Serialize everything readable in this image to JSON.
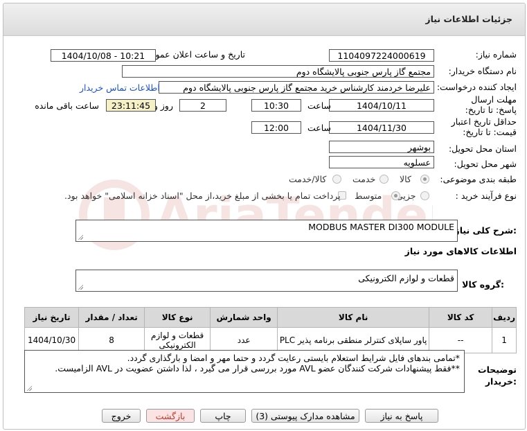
{
  "header": {
    "title": "جزئیات اطلاعات نیاز"
  },
  "fields": {
    "need_number_label": "شماره نیاز:",
    "need_number": "1104097224000619",
    "announce_label": "تاریخ و ساعت اعلان عمومی:",
    "announce_value": "1404/10/08 - 10:21",
    "buyer_org_label": "نام دستگاه خریدار:",
    "buyer_org": "مجتمع گاز پارس جنوبی  پالایشگاه دوم",
    "requester_label": "ایجاد کننده درخواست:",
    "requester": "علیرضا خردمند کارشناس خرید مجتمع گاز پارس جنوبی  پالایشگاه دوم",
    "contact_link": "اطلاعات تماس خریدار",
    "deadline_label": "مهلت ارسال پاسخ: تا تاریخ:",
    "deadline_date": "1404/10/11",
    "time_label": "ساعت",
    "deadline_time": "10:30",
    "days_value": "2",
    "days_label": "روز و",
    "remaining_time": "23:11:45",
    "remaining_label": "ساعت باقی مانده",
    "validity_label": "حداقل تاریخ اعتبار قیمت: تا تاریخ:",
    "validity_date": "1404/11/30",
    "validity_time": "12:00",
    "province_label": "استان محل تحویل:",
    "province": "بوشهر",
    "city_label": "شهر محل تحویل:",
    "city": "عسلویه",
    "category_label": "طبقه بندی موضوعی:",
    "category_options": [
      "کالا",
      "خدمت",
      "کالا/خدمت"
    ],
    "process_label": "نوع فرآیند خرید :",
    "process_options": [
      "جزیی",
      "متوسط"
    ],
    "treasury_note": "پرداخت تمام یا بخشی از مبلغ خرید،از محل \"اسناد خزانه اسلامی\" خواهد بود."
  },
  "summary": {
    "label": "شرح کلی نیاز:",
    "value": "MODBUS MASTER DI300 MODULE"
  },
  "goods_section": {
    "title": "اطلاعات کالاهای مورد نیاز"
  },
  "goods_group": {
    "label": "گروه کالا:",
    "value": "قطعات و لوازم الکترونیکی"
  },
  "table": {
    "headers": [
      "ردیف",
      "کد کالا",
      "نام کالا",
      "واحد شمارش",
      "نوع کالا",
      "تعداد / مقدار",
      "تاریخ نیاز"
    ],
    "rows": [
      [
        "1",
        "--",
        "پاور ساپلای کنترلر منطقی برنامه پذیر PLC",
        "عدد",
        "قطعات و لوازم الکترونیکی",
        "8",
        "1404/10/30"
      ]
    ]
  },
  "notes": {
    "label": "توضیحات خریدار:",
    "line1": "*تمامی بندهای فایل شرایط استعلام بایستی رعایت گردد و حتما مهر و امضا و بارگذاری گردد.",
    "line2": "**فقط پیشنهادات شرکت کنندگان عضو AVL مورد بررسی قرار می گیرد ، لذا داشتن عضویت در AVL الزامیست."
  },
  "buttons": {
    "reply": "پاسخ به نیاز",
    "docs": "مشاهده مدارک پیوستی (3)",
    "print": "چاپ",
    "back": "بازگشت",
    "exit": "خروج"
  },
  "watermark": "AriaTender.net",
  "colors": {
    "header_bg": "#e4e4e4",
    "link": "#1a4fd6",
    "time_bg": "#f6f0c7",
    "table_header": "#d9d9d9",
    "exit_text": "#c0392b"
  }
}
